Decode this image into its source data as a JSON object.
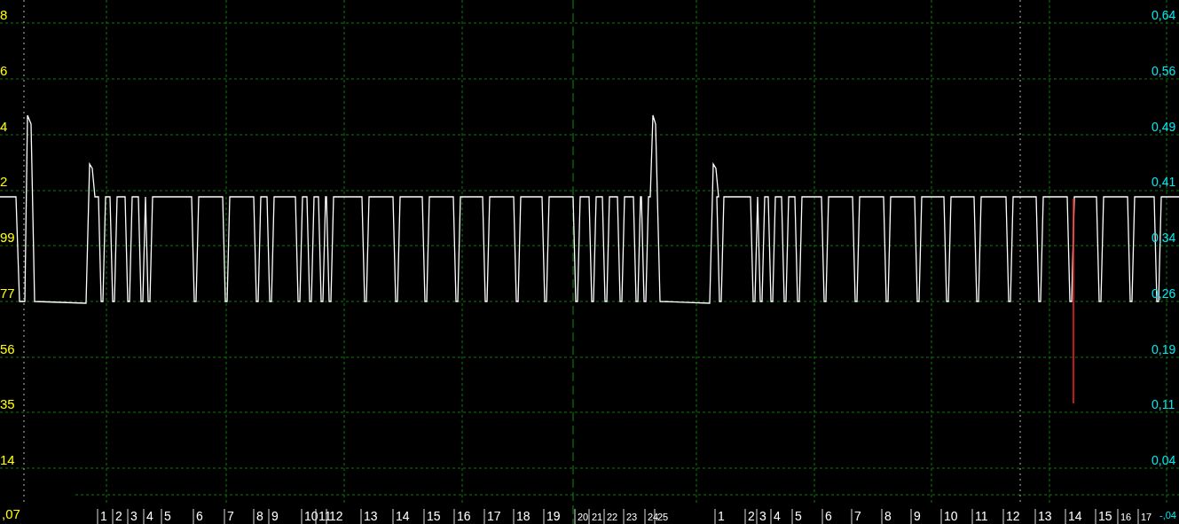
{
  "chart": {
    "left_axis_labels": [
      "8",
      "6",
      "4",
      "2",
      "99",
      "77",
      "56",
      "35",
      "14",
      ",07"
    ],
    "right_axis_labels": [
      "0,64",
      "0,56",
      "0,49",
      "0,41",
      "0,34",
      "0,26",
      "0,19",
      "0,11",
      "0,04",
      "-,04"
    ],
    "time_axis_labels": [
      "1",
      "2",
      "3",
      "4",
      "5",
      "6",
      "7",
      "8",
      "9",
      "10",
      "11",
      "12",
      "13",
      "14",
      "15",
      "16",
      "17",
      "18",
      "19",
      "20",
      "21",
      "22",
      "23",
      "24",
      "25",
      "1",
      "2",
      "3",
      "4",
      "5",
      "6",
      "7",
      "8",
      "9",
      "10",
      "11",
      "12",
      "13",
      "14",
      "15",
      "16",
      "17"
    ]
  }
}
